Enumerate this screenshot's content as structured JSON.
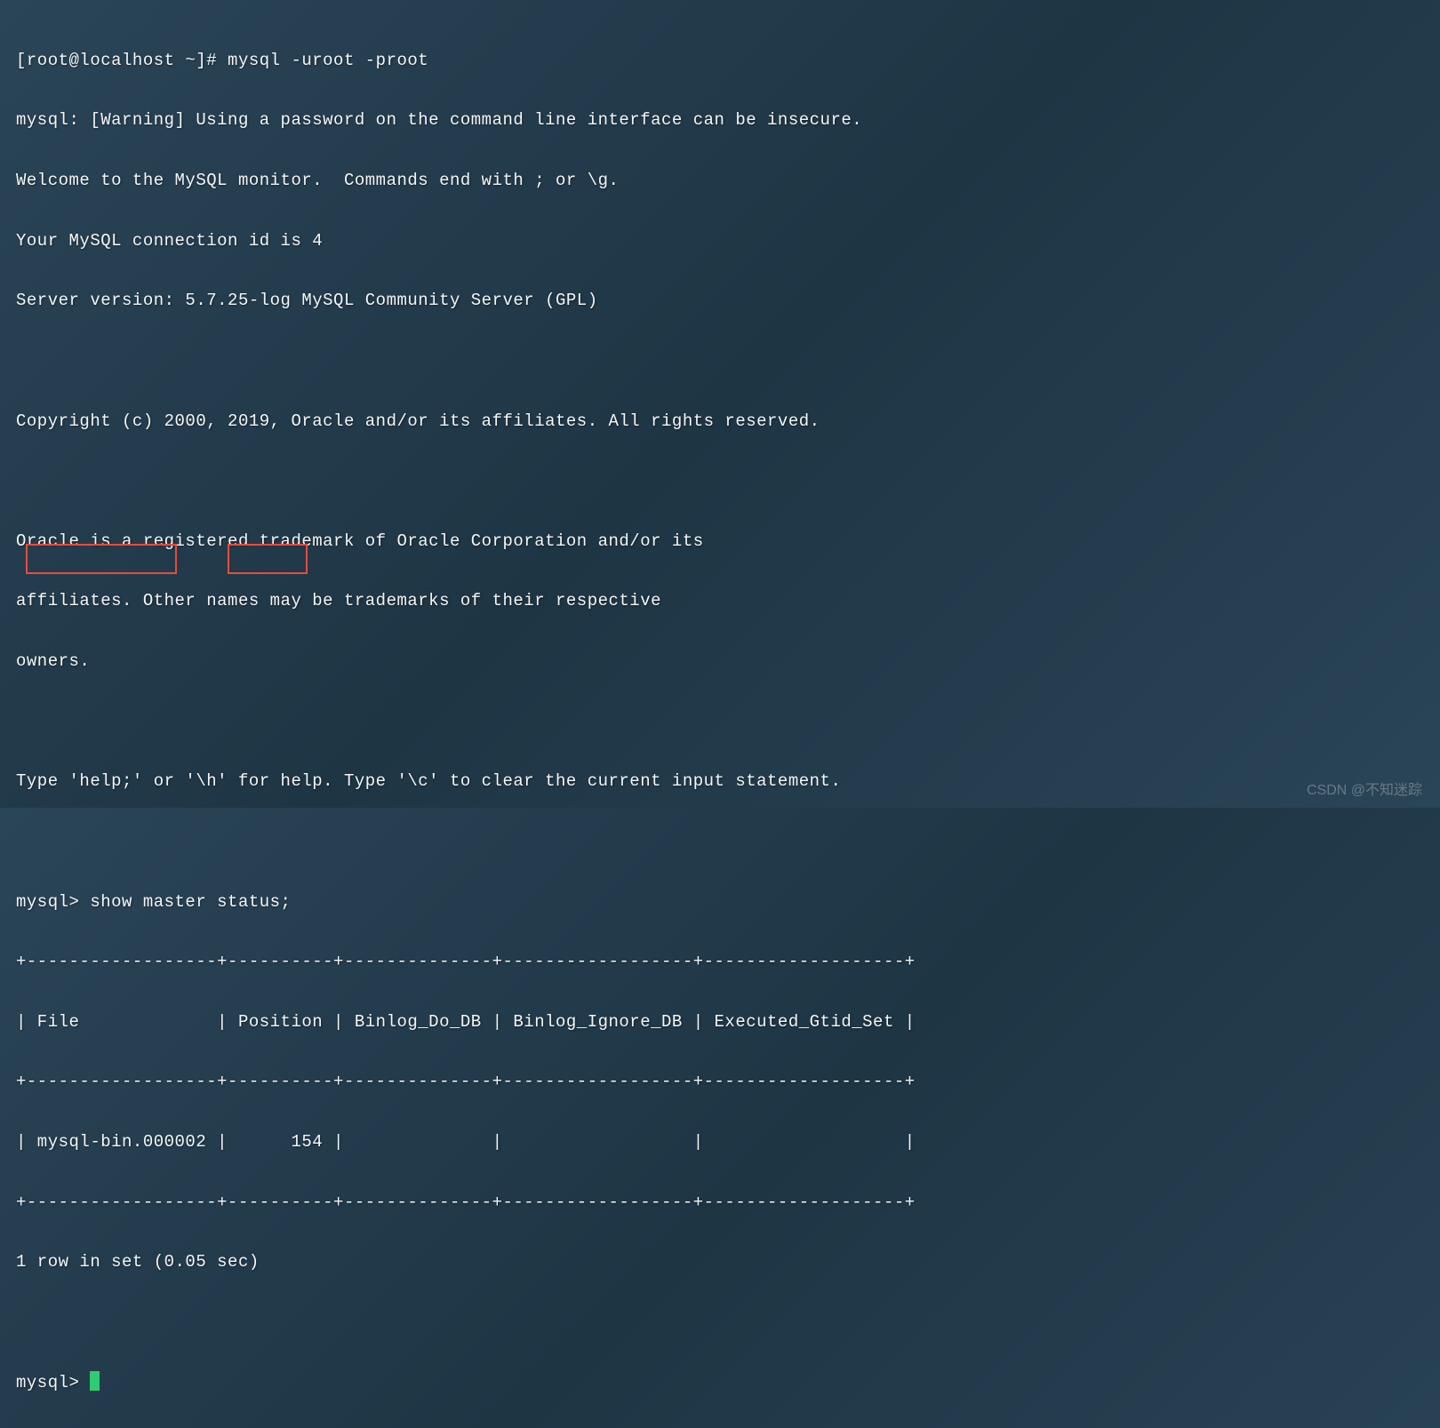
{
  "terminal": {
    "prompt_line": "[root@localhost ~]# mysql -uroot -proot",
    "warning_line": "mysql: [Warning] Using a password on the command line interface can be insecure.",
    "welcome_line": "Welcome to the MySQL monitor.  Commands end with ; or \\g.",
    "connection_line": "Your MySQL connection id is 4",
    "server_line": "Server version: 5.7.25-log MySQL Community Server (GPL)",
    "copyright_line": "Copyright (c) 2000, 2019, Oracle and/or its affiliates. All rights reserved.",
    "trademark_line1": "Oracle is a registered trademark of Oracle Corporation and/or its",
    "trademark_line2": "affiliates. Other names may be trademarks of their respective",
    "trademark_line3": "owners.",
    "help_line": "Type 'help;' or '\\h' for help. Type '\\c' to clear the current input statement.",
    "query_line": "mysql> show master status;",
    "table_border": "+------------------+----------+--------------+------------------+-------------------+",
    "table_header": "| File             | Position | Binlog_Do_DB | Binlog_Ignore_DB | Executed_Gtid_Set |",
    "table_row": "| mysql-bin.000002 |      154 |              |                  |                   |",
    "result_line": "1 row in set (0.05 sec)",
    "prompt2": "mysql> ",
    "highlighted_file": "mysql-bin.000002",
    "highlighted_position": "154"
  },
  "watermark": "CSDN @不知迷踪"
}
